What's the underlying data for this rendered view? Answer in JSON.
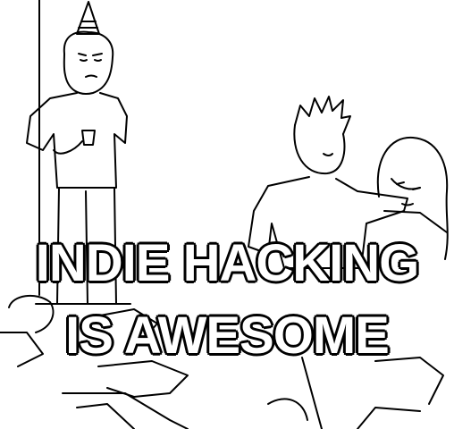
{
  "meme": {
    "caption_line1": "INDIE HACKING",
    "caption_line2": "IS AWESOME"
  },
  "colors": {
    "background": "#ffffff",
    "ink": "#000000",
    "text_fill": "#ffffff"
  }
}
